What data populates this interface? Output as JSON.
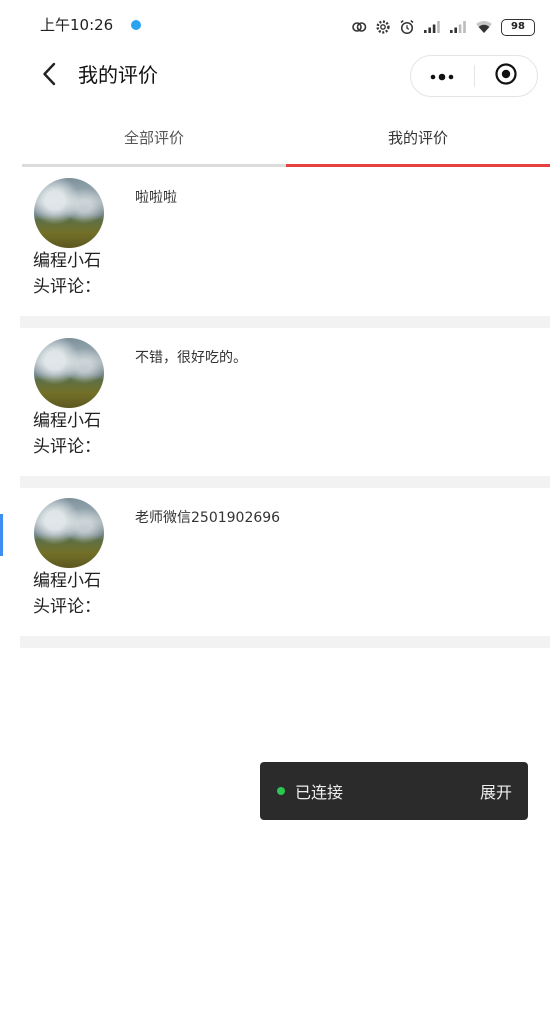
{
  "status_bar": {
    "time": "上午10:26",
    "battery": "98",
    "icons": [
      "link-icon",
      "gear-icon",
      "alarm-icon",
      "signal-icon",
      "signal-icon",
      "wifi-icon",
      "battery-icon"
    ]
  },
  "nav": {
    "title": "我的评价",
    "back_icon": "back-arrow-icon",
    "more_icon": "more-dots-icon",
    "exit_icon": "target-icon"
  },
  "tabs": [
    {
      "label": "全部评价",
      "active": false
    },
    {
      "label": "我的评价",
      "active": true
    }
  ],
  "comments": [
    {
      "author": "编程小石头评论：",
      "text": "啦啦啦"
    },
    {
      "author": "编程小石头评论：",
      "text": "不错，很好吃的。"
    },
    {
      "author": "编程小石头评论：",
      "text": "老师微信2501902696"
    }
  ],
  "toast": {
    "status": "已连接",
    "action": "展开"
  },
  "theme": {
    "accent": "#e64340",
    "status_dot": "#29a3f2",
    "toast_dot": "#2dc653",
    "toast_bg": "#2b2b2b"
  }
}
